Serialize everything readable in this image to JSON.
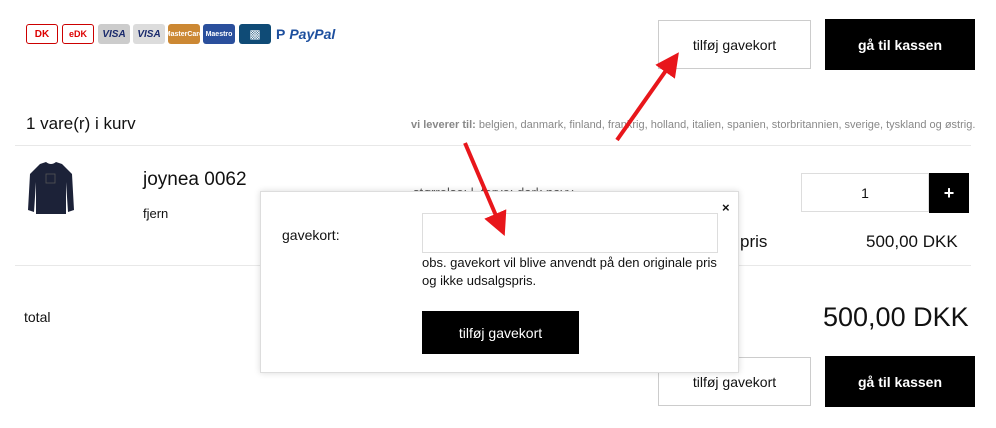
{
  "payment_logos": [
    "DK",
    "eDK",
    "VISA",
    "VISA",
    "MasterCard",
    "Maestro",
    "MobilePay",
    "PayPal"
  ],
  "header": {
    "add_giftcard_label": "tilføj gavekort",
    "checkout_label": "gå til kassen"
  },
  "cart": {
    "count_text": "1 vare(r) i kurv",
    "delivery_label": "vi leverer til:",
    "delivery_countries": "belgien, danmark, finland, frankrig, holland, italien, spanien, storbritannien, sverige, tyskland og østrig."
  },
  "item": {
    "name": "joynea 0062",
    "remove_label": "fjern",
    "attributes_text": "størrelse: l, farve: dark navy",
    "quantity": "1",
    "plus_label": "+",
    "price_label": "pris",
    "price_value": "500,00 DKK"
  },
  "totals": {
    "total_label": "total",
    "total_value": "500,00 DKK"
  },
  "footer": {
    "add_giftcard_label": "tilføj gavekort",
    "checkout_label": "gå til kassen"
  },
  "modal": {
    "close_label": "×",
    "field_label": "gavekort:",
    "input_value": "",
    "note": "obs. gavekort vil blive anvendt på den originale pris og ikke udsalgspris.",
    "submit_label": "tilføj gavekort"
  },
  "colors": {
    "accent": "#000000",
    "annotation_arrow": "#e8161b"
  }
}
